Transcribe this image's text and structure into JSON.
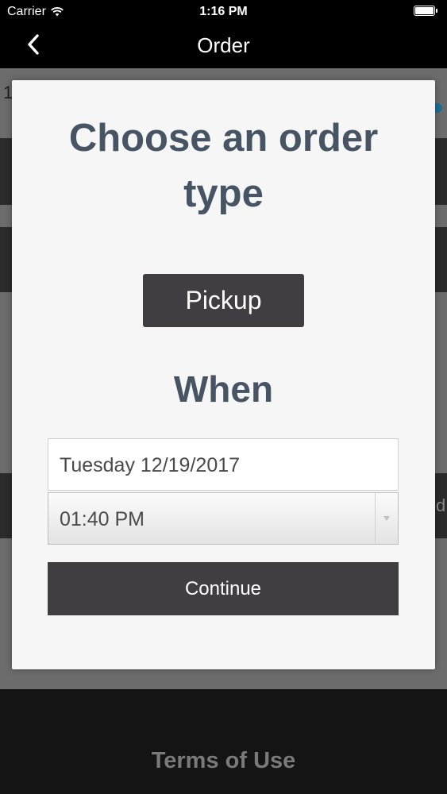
{
  "status_bar": {
    "carrier": "Carrier",
    "time": "1:16 PM",
    "icons": [
      "wifi-icon",
      "battery-icon"
    ]
  },
  "nav": {
    "title": "Order",
    "back_icon": "chevron-left-icon"
  },
  "modal": {
    "title": "Choose an order type",
    "order_type_button": "Pickup",
    "when_label": "When",
    "date_value": "Tuesday 12/19/2017",
    "time_value": "01:40 PM",
    "continue_label": "Continue"
  },
  "background": {
    "footer_link": "Terms of Use",
    "peek_left_top": "1",
    "peek_right_mid": "d"
  },
  "colors": {
    "bar_background": "#000000",
    "modal_background": "#f6f6f7",
    "heading_text": "#465463",
    "button_background": "#403e42",
    "button_text": "#ffffff",
    "dim_overlay": "#6c6c6c",
    "footer_link": "#7a7a7a"
  }
}
